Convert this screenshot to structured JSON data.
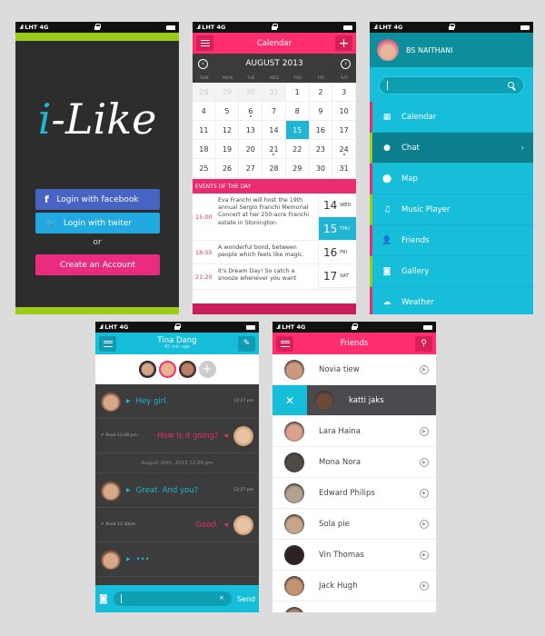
{
  "status_bar": {
    "carrier": "LHT",
    "network": "4G"
  },
  "colors": {
    "pink": "#ea2c6e",
    "cyan": "#17bed9",
    "green": "#9ccb1a",
    "dark": "#2d2d2d",
    "facebook": "#4763c4"
  },
  "login": {
    "logo_i": "i",
    "logo_rest": "-Like",
    "facebook_label": "Login with facebook",
    "twitter_label": "Login with twiter",
    "or_label": "or",
    "create_label": "Create an Account"
  },
  "calendar": {
    "title": "Calendar",
    "month": "AUGUST 2013",
    "weekdays": [
      "SUN",
      "MON",
      "TUE",
      "WED",
      "THU",
      "FRI",
      "SAT"
    ],
    "days": [
      {
        "d": "28",
        "m": true
      },
      {
        "d": "29",
        "m": true
      },
      {
        "d": "30",
        "m": true
      },
      {
        "d": "31",
        "m": true
      },
      {
        "d": "1"
      },
      {
        "d": "2"
      },
      {
        "d": "3"
      },
      {
        "d": "4"
      },
      {
        "d": "5"
      },
      {
        "d": "6",
        "dot": true
      },
      {
        "d": "7"
      },
      {
        "d": "8"
      },
      {
        "d": "9"
      },
      {
        "d": "10"
      },
      {
        "d": "11"
      },
      {
        "d": "12"
      },
      {
        "d": "13"
      },
      {
        "d": "14"
      },
      {
        "d": "15",
        "sel": true
      },
      {
        "d": "16"
      },
      {
        "d": "17"
      },
      {
        "d": "18"
      },
      {
        "d": "19"
      },
      {
        "d": "20"
      },
      {
        "d": "21",
        "dot": true
      },
      {
        "d": "22"
      },
      {
        "d": "23"
      },
      {
        "d": "24",
        "dot": true
      },
      {
        "d": "25"
      },
      {
        "d": "26"
      },
      {
        "d": "27"
      },
      {
        "d": "28"
      },
      {
        "d": "29"
      },
      {
        "d": "30"
      },
      {
        "d": "31"
      }
    ],
    "events_header": "EVENTS OF THE DAY",
    "events": [
      {
        "time": "15:00",
        "text": "Eva Franchi will host the 19th annual Sergio Franchi Memorial Concert at her 250-acre Franchi estate in Stonington."
      },
      {
        "time": "18:55",
        "text": "A wonderful bond,  between people which feels like magic."
      },
      {
        "time": "21:20",
        "text": "It's Dream Day! So catch a snooze whenever you want"
      }
    ],
    "day_column": [
      {
        "num": "14",
        "dow": "WED"
      },
      {
        "num": "15",
        "dow": "THU",
        "sel": true
      },
      {
        "num": "16",
        "dow": "FRI"
      },
      {
        "num": "17",
        "dow": "SAT"
      }
    ]
  },
  "menu": {
    "user_name": "BS NAITHANI",
    "search_placeholder": "",
    "items": [
      {
        "label": "Calendar",
        "icon": "▦"
      },
      {
        "label": "Chat",
        "icon": "●",
        "active": true
      },
      {
        "label": "Map",
        "icon": "⬤"
      },
      {
        "label": "Music Player",
        "icon": "♫"
      },
      {
        "label": "Friends",
        "icon": "👤"
      },
      {
        "label": "Gallery",
        "icon": "◙"
      },
      {
        "label": "Weather",
        "icon": "☁"
      }
    ]
  },
  "chat": {
    "name": "Tina Dang",
    "last_seen": "45 min ago",
    "messages": [
      {
        "dir": "in",
        "text": "Hey girl.",
        "time": "12:27 pm"
      },
      {
        "dir": "out",
        "text": "How is it going?",
        "read": "Read 12:28 pm"
      },
      {
        "sep": "August 20th, 2013    12:29 pm"
      },
      {
        "dir": "in",
        "text": "Great. And you?",
        "time": "12:27 pm"
      },
      {
        "dir": "out",
        "text": "Good.",
        "read": "Read 12:30pm"
      },
      {
        "dir": "in",
        "text": "•••"
      }
    ],
    "input_value": "",
    "send_label": "Send"
  },
  "friends": {
    "title": "Friends",
    "list": [
      {
        "name": "Novia tiew"
      },
      {
        "name": "katti jaks",
        "swiped": true
      },
      {
        "name": "Lara Haina"
      },
      {
        "name": "Mona Nora"
      },
      {
        "name": "Edward Philips"
      },
      {
        "name": "Sola pie"
      },
      {
        "name": "Vin Thomas"
      },
      {
        "name": "Jack Hugh"
      },
      {
        "name": ""
      }
    ]
  }
}
